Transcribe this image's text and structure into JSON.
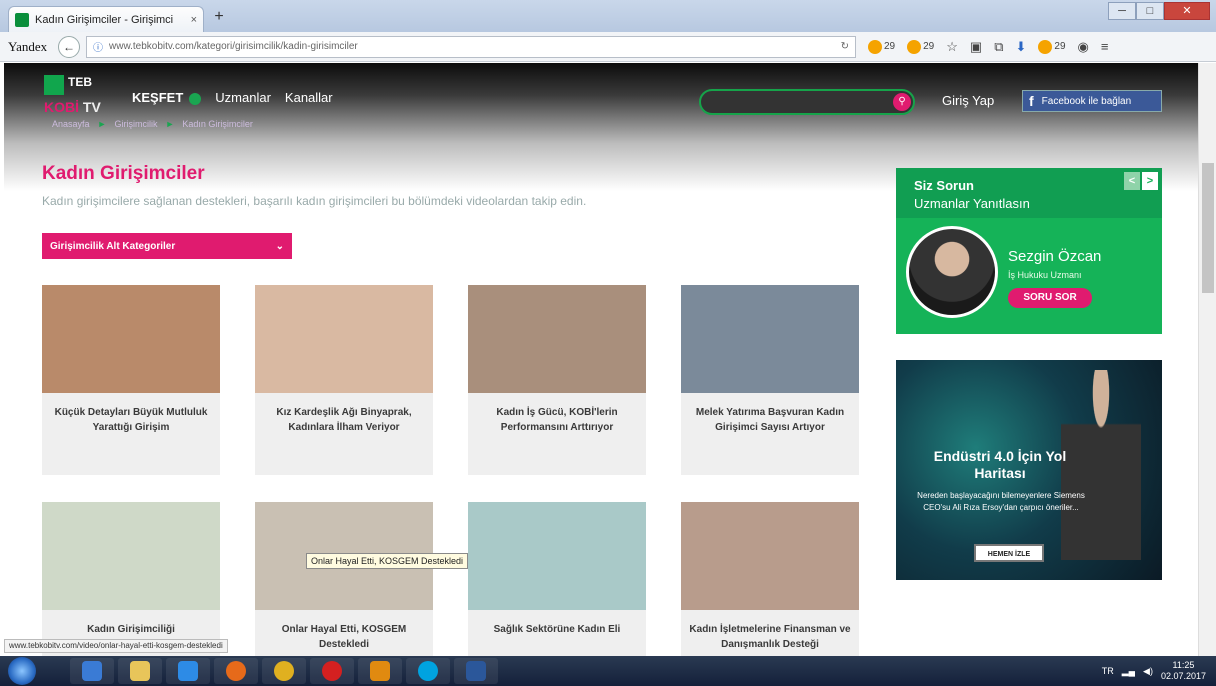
{
  "browser": {
    "tab_title": "Kadın Girişimciler - Girişimci",
    "tab_close": "×",
    "new_tab": "+",
    "search_engine": "Yandex",
    "url": "www.tebkobitv.com/kategori/girisimcilik/kadin-girisimciler",
    "addon_counts": [
      "29",
      "29",
      "29"
    ]
  },
  "site": {
    "logo_teb": "TEB",
    "logo_kobi": "KOBİ",
    "logo_tv": "TV",
    "nav": [
      "KEŞFET",
      "Uzmanlar",
      "Kanallar"
    ],
    "login": "Giriş Yap",
    "facebook": "Facebook ile bağlan",
    "breadcrumb": [
      "Anasayfa",
      "Girişimcilik",
      "Kadın Girişimciler"
    ]
  },
  "page": {
    "title": "Kadın Girişimciler",
    "subtitle": "Kadın girişimcilere sağlanan destekleri, başarılı kadın girişimcileri bu bölümdeki videolardan takip edin.",
    "subcategory_dropdown": "Girişimcilik Alt Kategoriler",
    "dropdown_arrow": "⌄"
  },
  "cards": [
    {
      "caption": "Küçük Detayları Büyük Mutluluk Yarattığı Girişim",
      "color": "#b98a6a"
    },
    {
      "caption": "Kız Kardeşlik Ağı Binyaprak, Kadınlara İlham Veriyor",
      "color": "#d9b9a2"
    },
    {
      "caption": "Kadın İş Gücü, KOBİ'lerin Performansını Arttırıyor",
      "color": "#a98f7c"
    },
    {
      "caption": "Melek Yatırıma Başvuran Kadın Girişimci Sayısı Artıyor",
      "color": "#7b8a9a"
    },
    {
      "caption": "Kadın Girişimciliği",
      "color": "#cfd9c8"
    },
    {
      "caption": "Onlar Hayal Etti, KOSGEM Destekledi",
      "color": "#c9c0b3"
    },
    {
      "caption": "Sağlık Sektörüne Kadın Eli",
      "color": "#a9c9c8"
    },
    {
      "caption": "Kadın İşletmelerine Finansman ve Danışmanlık Desteği",
      "color": "#b89c8c"
    }
  ],
  "sidebar": {
    "ask_title": "Siz Sorun",
    "ask_sub": "Uzmanlar Yanıtlasın",
    "expert_name": "Sezgin Özcan",
    "expert_role": "İş Hukuku Uzmanı",
    "ask_button": "SORU SOR",
    "prev": "<",
    "next": ">",
    "promo_title": "Endüstri 4.0 İçin Yol Haritası",
    "promo_desc": "Nereden başlayacağını bilemeyenlere Siemens CEO'su Ali Rıza Ersoy'dan çarpıcı öneriler...",
    "promo_button": "HEMEN İZLE"
  },
  "tooltip": "Onlar Hayal Etti, KOSGEM Destekledi",
  "status_url": "www.tebkobitv.com/video/onlar-hayal-etti-kosgem-destekledi",
  "taskbar": {
    "lang": "TR",
    "time": "11:25",
    "date": "02.07.2017"
  }
}
